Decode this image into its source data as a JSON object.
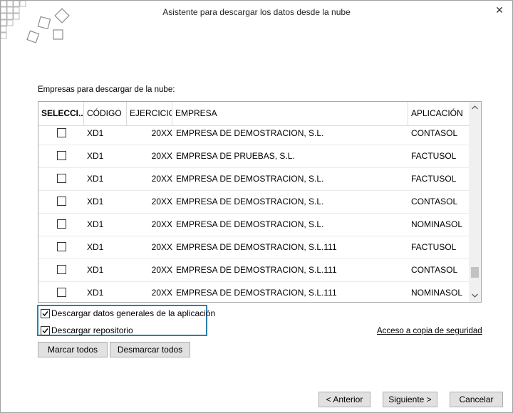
{
  "window": {
    "title": "Asistente para descargar los datos desde la nube",
    "close_glyph": "✕"
  },
  "list": {
    "caption": "Empresas para descargar de la nube:",
    "columns": {
      "seleccion": "SELECCI...",
      "codigo": "CÓDIGO",
      "ejercicio": "EJERCICIO",
      "empresa": "EMPRESA",
      "aplicacion": "APLICACIÓN"
    },
    "rows": [
      {
        "selected": false,
        "codigo": "XD1",
        "ejercicio": "20XX",
        "empresa": "EMPRESA DE DEMOSTRACION, S.L.",
        "aplicacion": "CONTASOL"
      },
      {
        "selected": false,
        "codigo": "XD1",
        "ejercicio": "20XX",
        "empresa": "EMPRESA DE PRUEBAS, S.L.",
        "aplicacion": "FACTUSOL"
      },
      {
        "selected": false,
        "codigo": "XD1",
        "ejercicio": "20XX",
        "empresa": "EMPRESA DE DEMOSTRACION, S.L.",
        "aplicacion": "FACTUSOL"
      },
      {
        "selected": false,
        "codigo": "XD1",
        "ejercicio": "20XX",
        "empresa": "EMPRESA DE DEMOSTRACION, S.L.",
        "aplicacion": "CONTASOL"
      },
      {
        "selected": false,
        "codigo": "XD1",
        "ejercicio": "20XX",
        "empresa": "EMPRESA DE DEMOSTRACION, S.L.",
        "aplicacion": "NOMINASOL"
      },
      {
        "selected": false,
        "codigo": "XD1",
        "ejercicio": "20XX",
        "empresa": "EMPRESA DE DEMOSTRACION, S.L.111",
        "aplicacion": "FACTUSOL"
      },
      {
        "selected": false,
        "codigo": "XD1",
        "ejercicio": "20XX",
        "empresa": "EMPRESA DE DEMOSTRACION, S.L.111",
        "aplicacion": "CONTASOL"
      },
      {
        "selected": false,
        "codigo": "XD1",
        "ejercicio": "20XX",
        "empresa": "EMPRESA DE DEMOSTRACION, S.L.111",
        "aplicacion": "NOMINASOL"
      }
    ],
    "scroll_position": 0.92
  },
  "options": {
    "datos_generales": {
      "label": "Descargar datos generales de la aplicación",
      "checked": true
    },
    "repositorio": {
      "label": "Descargar repositorio",
      "checked": true
    }
  },
  "link_copia": "Acceso a copia de seguridad",
  "buttons": {
    "marcar_todos": "Marcar todos",
    "desmarcar_todos": "Desmarcar todos",
    "anterior": "< Anterior",
    "siguiente": "Siguiente >",
    "cancelar": "Cancelar"
  },
  "colors": {
    "focus_border": "#2a7fb0",
    "button_bg": "#e1e1e1"
  },
  "icons": {
    "close": "close-icon",
    "scroll_up": "chevron-up-icon",
    "scroll_down": "chevron-down-icon",
    "checkmark": "checkmark-icon",
    "logo": "diamond-squares-logo"
  }
}
